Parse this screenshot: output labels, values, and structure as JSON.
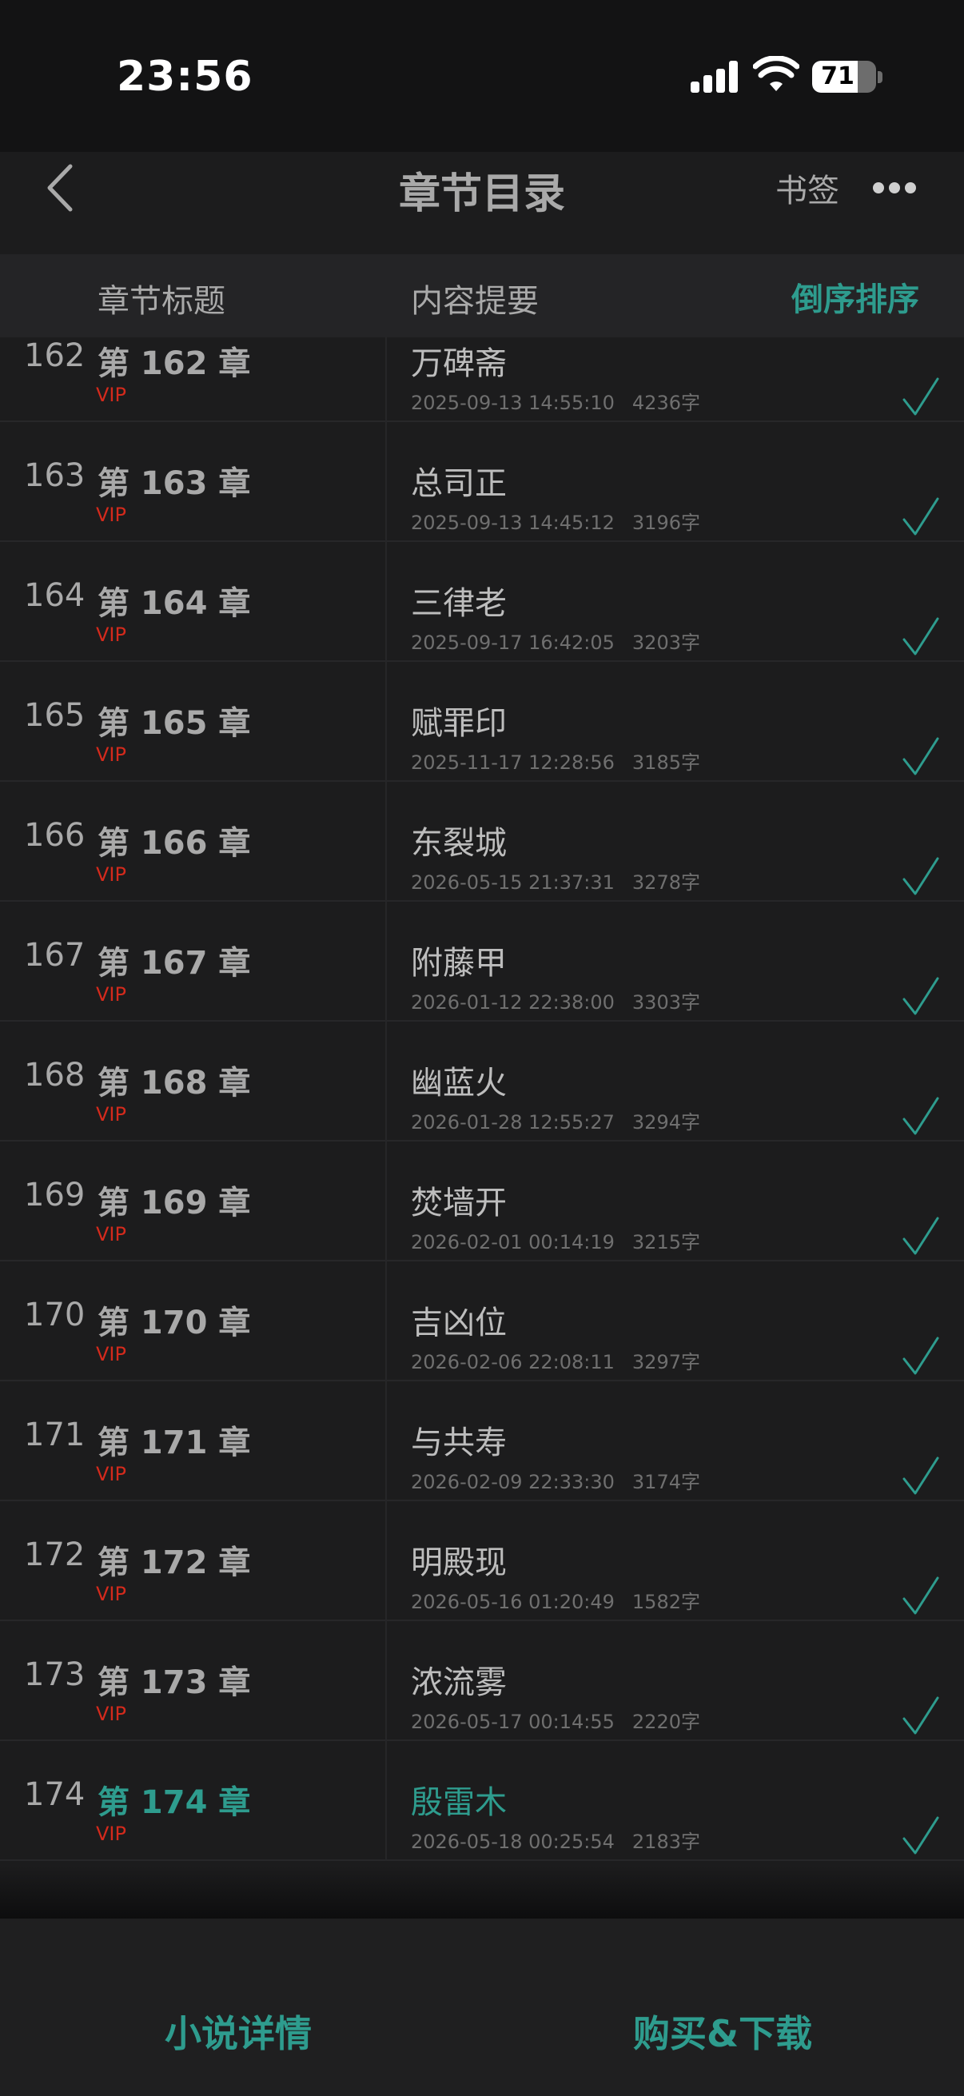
{
  "status_bar": {
    "time": "23:56",
    "battery": "71",
    "battery_level": 0.71,
    "icons": [
      "signal-icon",
      "wifi-icon",
      "battery-icon"
    ]
  },
  "nav": {
    "title": "章节目录",
    "bookmark": "书签",
    "back_icon": "chevron-left-icon",
    "more_icon": "more-icon"
  },
  "header": {
    "col_title": "章节标题",
    "col_summary": "内容提要",
    "sort": "倒序排序"
  },
  "chapters": [
    {
      "num": "162",
      "chapter": "第 162 章",
      "vip": "VIP",
      "name": "万碑斋",
      "date": "2025-09-13 14:55:10",
      "words": "4236字",
      "status_icon": "check-icon"
    },
    {
      "num": "163",
      "chapter": "第 163 章",
      "vip": "VIP",
      "name": "总司正",
      "date": "2025-09-13 14:45:12",
      "words": "3196字",
      "status_icon": "check-icon"
    },
    {
      "num": "164",
      "chapter": "第 164 章",
      "vip": "VIP",
      "name": "三律老",
      "date": "2025-09-17 16:42:05",
      "words": "3203字",
      "status_icon": "check-icon"
    },
    {
      "num": "165",
      "chapter": "第 165 章",
      "vip": "VIP",
      "name": "赋罪印",
      "date": "2025-11-17 12:28:56",
      "words": "3185字",
      "status_icon": "check-icon"
    },
    {
      "num": "166",
      "chapter": "第 166 章",
      "vip": "VIP",
      "name": "东裂城",
      "date": "2026-05-15 21:37:31",
      "words": "3278字",
      "status_icon": "check-icon"
    },
    {
      "num": "167",
      "chapter": "第 167 章",
      "vip": "VIP",
      "name": "附藤甲",
      "date": "2026-01-12 22:38:00",
      "words": "3303字",
      "status_icon": "check-icon"
    },
    {
      "num": "168",
      "chapter": "第 168 章",
      "vip": "VIP",
      "name": "幽蓝火",
      "date": "2026-01-28 12:55:27",
      "words": "3294字",
      "status_icon": "check-icon"
    },
    {
      "num": "169",
      "chapter": "第 169 章",
      "vip": "VIP",
      "name": "焚墙开",
      "date": "2026-02-01 00:14:19",
      "words": "3215字",
      "status_icon": "check-icon"
    },
    {
      "num": "170",
      "chapter": "第 170 章",
      "vip": "VIP",
      "name": "吉凶位",
      "date": "2026-02-06 22:08:11",
      "words": "3297字",
      "status_icon": "check-icon"
    },
    {
      "num": "171",
      "chapter": "第 171 章",
      "vip": "VIP",
      "name": "与共寿",
      "date": "2026-02-09 22:33:30",
      "words": "3174字",
      "status_icon": "check-icon"
    },
    {
      "num": "172",
      "chapter": "第 172 章",
      "vip": "VIP",
      "name": "明殿现",
      "date": "2026-05-16 01:20:49",
      "words": "1582字",
      "status_icon": "check-icon"
    },
    {
      "num": "173",
      "chapter": "第 173 章",
      "vip": "VIP",
      "name": "浓流雾",
      "date": "2026-05-17 00:14:55",
      "words": "2220字",
      "status_icon": "check-icon"
    },
    {
      "num": "174",
      "chapter": "第 174 章",
      "vip": "VIP",
      "name": "殷雷木",
      "date": "2026-05-18 00:25:54",
      "words": "2183字",
      "status_icon": "check-icon",
      "current": true
    }
  ],
  "footer": {
    "detail": "小说详情",
    "buy": "购买&下载"
  },
  "colors": {
    "accent": "#2e9c8e",
    "vip": "#d42a1c",
    "background": "#1c1c1d"
  }
}
